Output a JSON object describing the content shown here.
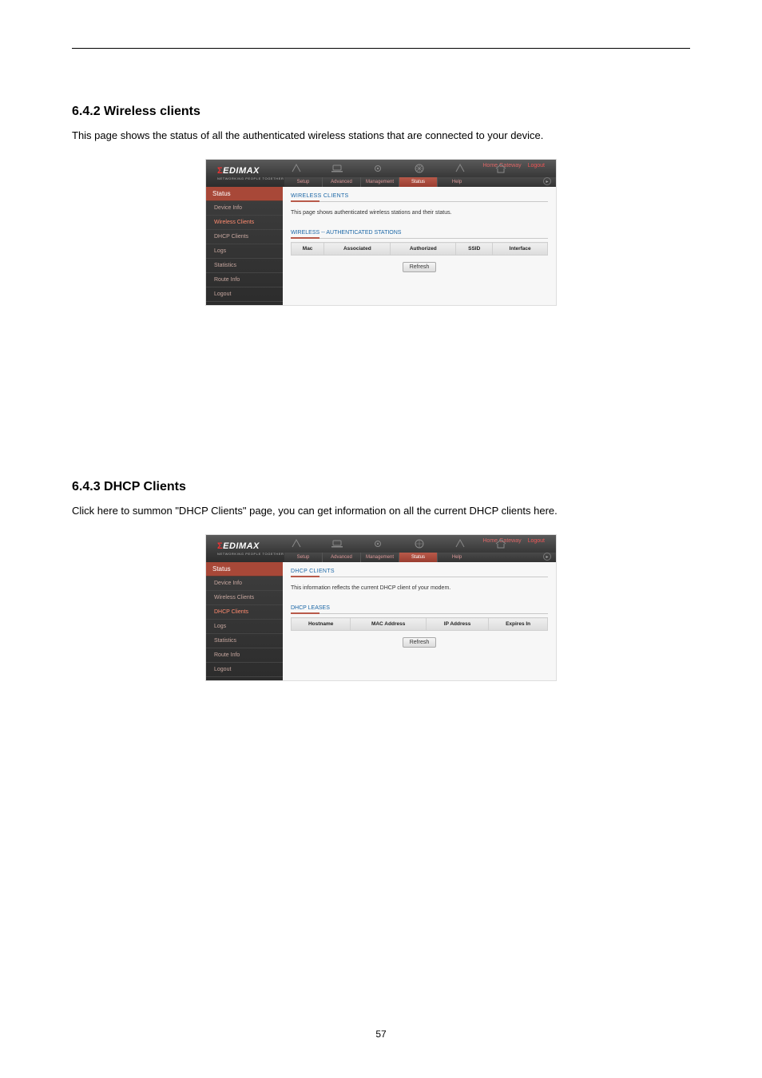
{
  "page_number": "57",
  "sections": [
    {
      "key": "wireless_clients_section",
      "title": "6.4.2 Wireless clients",
      "desc": "This page shows the status of all the authenticated wireless stations that are connected to your device."
    },
    {
      "key": "dhcp_clients_section",
      "title": "6.4.3 DHCP Clients",
      "desc": "Click here to summon \"DHCP Clients\" page, you can get information on all the current DHCP clients here."
    }
  ],
  "common": {
    "brand": "EDIMAX",
    "brand_sub": "NETWORKING PEOPLE TOGETHER",
    "home_label": "Home Gateway",
    "logout": "Logout",
    "tabs": [
      "Setup",
      "Advanced",
      "Management",
      "Status",
      "Help"
    ],
    "sidebar_head": "Status",
    "sidebar_items": [
      "Device Info",
      "Wireless Clients",
      "DHCP Clients",
      "Logs",
      "Statistics",
      "Route Info",
      "Logout"
    ],
    "refresh": "Refresh"
  },
  "pane_wireless": {
    "active_side_index": 1,
    "panel_title": "WIRELESS CLIENTS",
    "note": "This page shows authenticated wireless stations and their status.",
    "subtitle": "WIRELESS -- AUTHENTICATED STATIONS",
    "columns": [
      "Mac",
      "Associated",
      "Authorized",
      "SSID",
      "Interface"
    ]
  },
  "pane_dhcp": {
    "active_side_index": 2,
    "panel_title": "DHCP CLIENTS",
    "note": "This information reflects the current DHCP client of your modem.",
    "subtitle": "DHCP LEASES",
    "columns": [
      "Hostname",
      "MAC Address",
      "IP Address",
      "Expires In"
    ]
  }
}
